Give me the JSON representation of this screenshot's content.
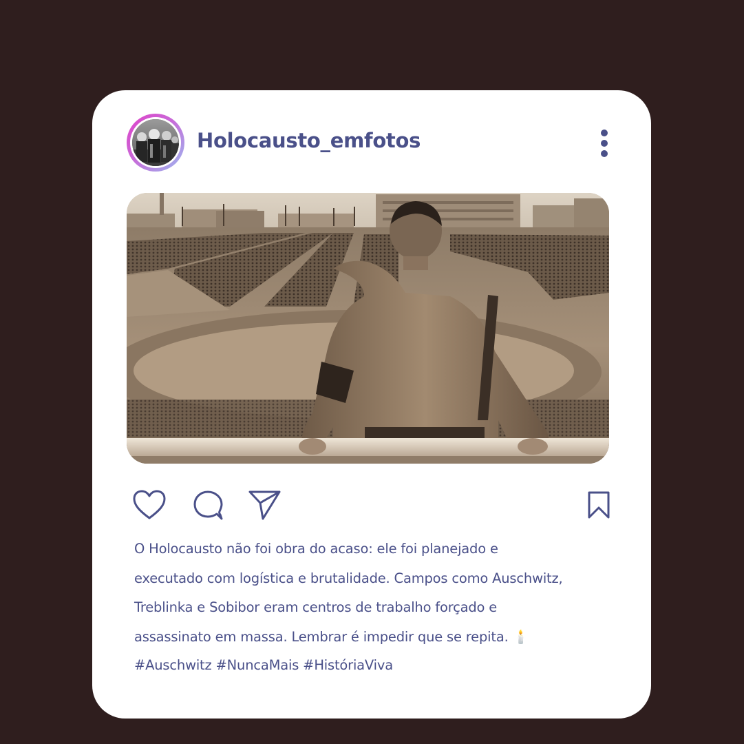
{
  "post": {
    "username": "Holocausto_emfotos",
    "caption": "O Holocausto não foi obra do acaso: ele foi planejado e\nexecutado com logística e brutalidade. Campos como Auschwitz,\nTreblinka e Sobibor eram centros de trabalho forçado e\nassassinato em massa. Lembrar é impedir que se repita. 🕯️",
    "hashtags": "#Auschwitz #NuncaMais #HistóriaViva"
  },
  "icons": {
    "avatar": "avatar-photo",
    "more": "more-vertical-icon",
    "like": "heart-icon",
    "comment": "comment-bubble-icon",
    "share": "send-icon",
    "save": "bookmark-icon"
  },
  "colors": {
    "background": "#2f1e1e",
    "card": "#ffffff",
    "accent_text": "#4a5089",
    "avatar_gradient_start": "#e040c8",
    "avatar_gradient_end": "#9cb8f0"
  }
}
